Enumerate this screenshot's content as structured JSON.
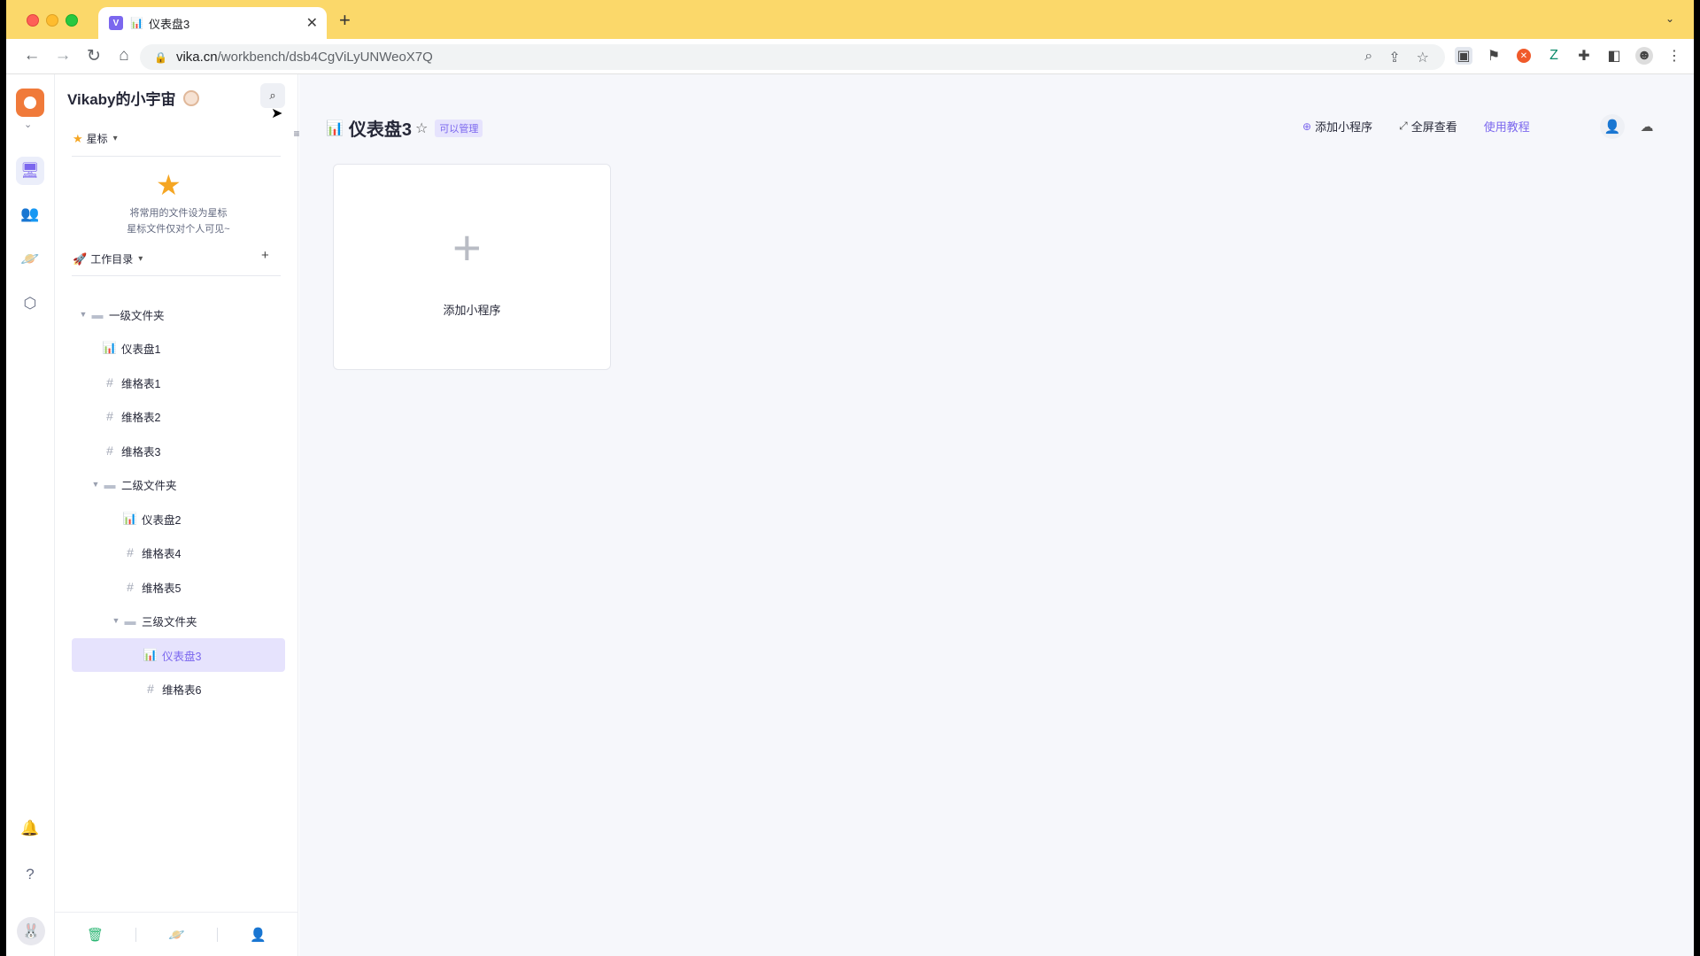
{
  "browser": {
    "tab_title": "仪表盘3",
    "tab_favicon": "vika-logo-icon",
    "url_domain": "vika.cn",
    "url_path": "/workbench/dsb4CgViLyUNWeoX7Q"
  },
  "rail": {
    "items": [
      "workbench-icon",
      "members-icon",
      "explore-icon",
      "settings-icon"
    ],
    "bottom": [
      "notification-icon",
      "help-icon"
    ]
  },
  "sidebar": {
    "space_name": "Vikaby的小宇宙",
    "starred": {
      "label": "星标",
      "empty_line1": "将常用的文件设为星标",
      "empty_line2": "星标文件仅对个人可见~"
    },
    "catalog_label": "工作目录",
    "tree": [
      {
        "label": "一级文件夹",
        "type": "folder",
        "level": 0
      },
      {
        "label": "仪表盘1",
        "type": "dashboard",
        "level": 1
      },
      {
        "label": "维格表1",
        "type": "datasheet",
        "level": 1
      },
      {
        "label": "维格表2",
        "type": "datasheet",
        "level": 1
      },
      {
        "label": "维格表3",
        "type": "datasheet",
        "level": 1
      },
      {
        "label": "二级文件夹",
        "type": "folder",
        "level": 1
      },
      {
        "label": "仪表盘2",
        "type": "dashboard",
        "level": 2
      },
      {
        "label": "维格表4",
        "type": "datasheet",
        "level": 2
      },
      {
        "label": "维格表5",
        "type": "datasheet",
        "level": 2
      },
      {
        "label": "三级文件夹",
        "type": "folder",
        "level": 2
      },
      {
        "label": "仪表盘3",
        "type": "dashboard",
        "level": 3,
        "active": true
      },
      {
        "label": "维格表6",
        "type": "datasheet",
        "level": 3
      }
    ],
    "footer": [
      "trash-icon",
      "planet-icon",
      "invite-icon"
    ]
  },
  "main": {
    "title": "仪表盘3",
    "permission": "可以管理",
    "actions": {
      "add_widget": "添加小程序",
      "fullscreen": "全屏查看",
      "tutorial": "使用教程"
    },
    "widget_card_label": "添加小程序"
  },
  "colors": {
    "accent": "#7b67ee",
    "tab_bar": "#fbd86a",
    "active_row": "#e6e3fd"
  }
}
